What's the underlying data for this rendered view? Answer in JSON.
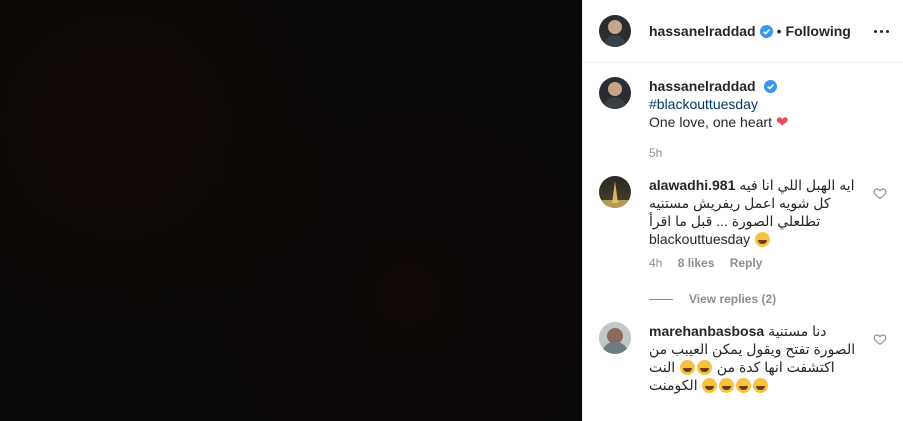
{
  "header": {
    "username": "hassanelraddad",
    "separator": "•",
    "follow_status": "Following"
  },
  "post": {
    "username": "hassanelraddad",
    "hashtag": "#blackouttuesday",
    "caption": "One love, one heart",
    "time": "5h"
  },
  "comments": [
    {
      "username": "alawadhi.981",
      "text": "ايه الهبل اللي انا فيه كل شويه اعمل ريفريش مستنيه تطلعلي الصورة ... قبل ما اقرأ blackouttuesday",
      "time": "4h",
      "likes": "8 likes",
      "reply": "Reply",
      "view_replies": "View replies (2)"
    },
    {
      "username": "marehanbasbosa",
      "text": "دنا مستنية الصورة تفتح ويقول يمكن العيبب من النت",
      "text2": "اكتشفت انها كدة من الكومنت"
    }
  ],
  "colors": {
    "verified": "#3897f0",
    "hashtag": "#00376b",
    "heart": "#ed4956"
  },
  "icons": {
    "verified": "verified-badge-icon",
    "more": "more-options-icon",
    "like": "heart-outline-icon"
  }
}
